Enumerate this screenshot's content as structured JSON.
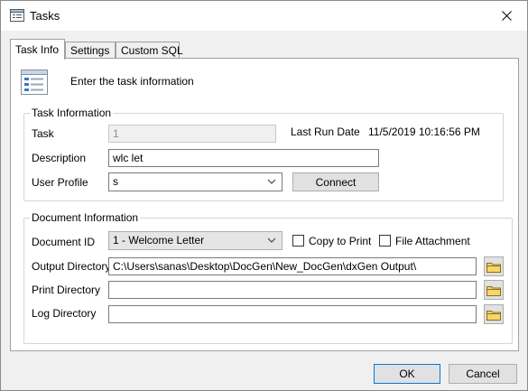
{
  "window": {
    "title": "Tasks"
  },
  "tabs": [
    {
      "label": "Task Info"
    },
    {
      "label": "Settings"
    },
    {
      "label": "Custom SQL"
    }
  ],
  "header": {
    "text": "Enter the task information"
  },
  "task_information": {
    "group_label": "Task Information",
    "task_label": "Task",
    "task_value": "1",
    "last_run_label": "Last Run Date",
    "last_run_value": "11/5/2019 10:16:56 PM",
    "description_label": "Description",
    "description_value": "wlc let",
    "user_profile_label": "User Profile",
    "user_profile_value": "s",
    "connect_label": "Connect"
  },
  "document_information": {
    "group_label": "Document Information",
    "document_id_label": "Document ID",
    "document_id_value": "1 - Welcome Letter",
    "copy_to_print_label": "Copy to Print",
    "file_attachment_label": "File Attachment",
    "output_dir_label": "Output Directory",
    "output_dir_value": "C:\\Users\\sanas\\Desktop\\DocGen\\New_DocGen\\dxGen Output\\",
    "print_dir_label": "Print Directory",
    "print_dir_value": "",
    "log_dir_label": "Log Directory",
    "log_dir_value": ""
  },
  "footer": {
    "ok_label": "OK",
    "cancel_label": "Cancel"
  },
  "colors": {
    "accent": "#0078d7",
    "button_face": "#e1e1e1",
    "folder_yellow": "#f5d66b"
  }
}
